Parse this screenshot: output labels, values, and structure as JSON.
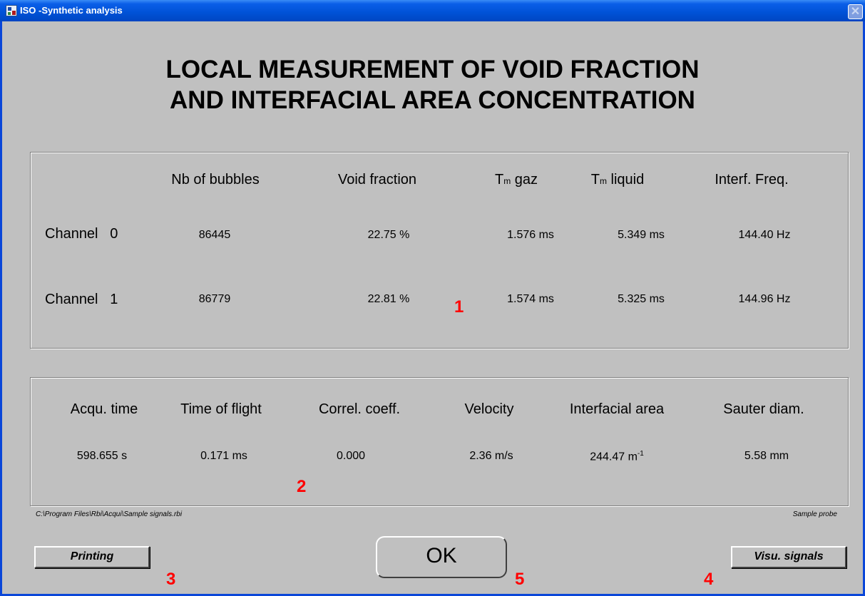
{
  "window": {
    "title": "ISO -Synthetic analysis",
    "close_symbol": "✕"
  },
  "heading": {
    "line1": "LOCAL MEASUREMENT OF VOID FRACTION",
    "line2": "AND INTERFACIAL AREA CONCENTRATION"
  },
  "panel1": {
    "headers": {
      "nb_bubbles": "Nb of bubbles",
      "void_fraction": "Void fraction",
      "tm_gaz_main": "T",
      "tm_gaz_sub": "m",
      "tm_gaz_rest": " gaz",
      "tm_liquid_main": "T",
      "tm_liquid_sub": "m",
      "tm_liquid_rest": " liquid",
      "interf_freq": "Interf. Freq."
    },
    "rows": [
      {
        "label": "Channel",
        "index": "0",
        "nb_bubbles": "86445",
        "void_fraction": "22.75 %",
        "tm_gaz": "1.576 ms",
        "tm_liquid": "5.349 ms",
        "interf_freq": "144.40 Hz"
      },
      {
        "label": "Channel",
        "index": "1",
        "nb_bubbles": "86779",
        "void_fraction": "22.81 %",
        "tm_gaz": "1.574 ms",
        "tm_liquid": "5.325 ms",
        "interf_freq": "144.96 Hz"
      }
    ]
  },
  "panel2": {
    "headers": {
      "acqu_time": "Acqu. time",
      "time_of_flight": "Time of flight",
      "correl_coeff": "Correl. coeff.",
      "velocity": "Velocity",
      "interfacial_area": "Interfacial area",
      "sauter_diam": "Sauter diam."
    },
    "values": {
      "acqu_time": "598.655 s",
      "time_of_flight": "0.171 ms",
      "correl_coeff": "0.000",
      "velocity": "2.36 m/s",
      "interfacial_area": "244.47 m",
      "interfacial_area_sup": "-1",
      "sauter_diam": "5.58 mm"
    }
  },
  "footer": {
    "file_path": "C:\\Program Files\\Rbi\\Acqui\\Sample signals.rbi",
    "probe_name": "Sample probe"
  },
  "buttons": {
    "printing": "Printing",
    "ok": "OK",
    "visu_signals": "Visu. signals"
  },
  "annotations": {
    "a1": "1",
    "a2": "2",
    "a3": "3",
    "a4": "4",
    "a5": "5"
  },
  "colors": {
    "titlebar": "#0052d6",
    "window_bg": "#c0c0c0",
    "annotation": "#ff0000"
  }
}
